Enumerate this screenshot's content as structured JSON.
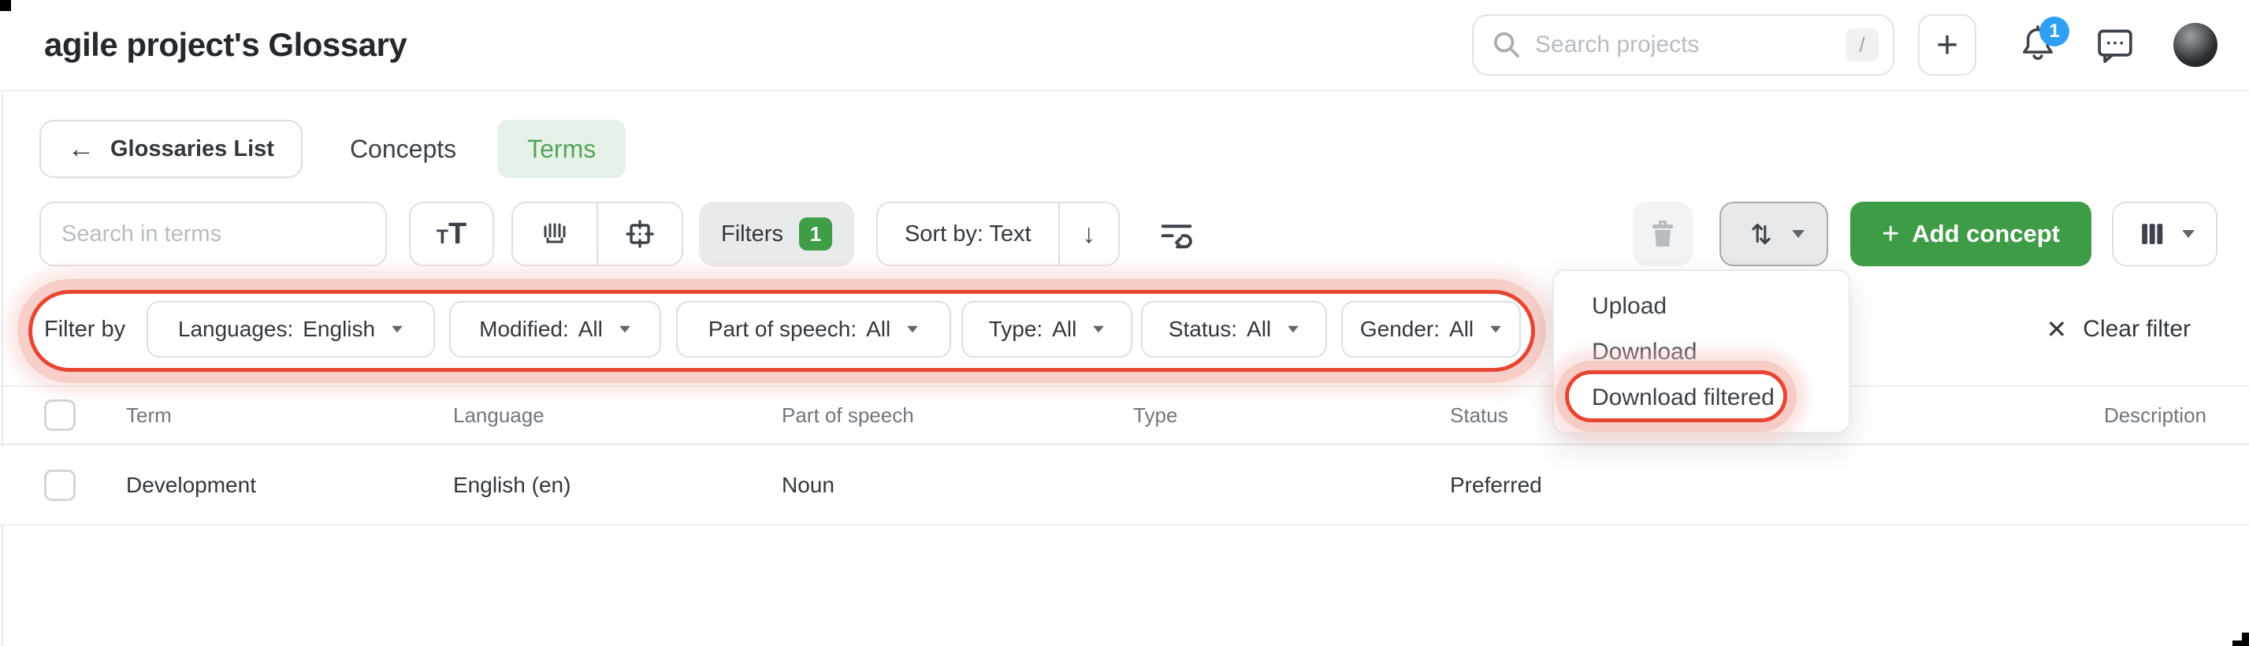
{
  "header": {
    "title": "agile project's Glossary",
    "search_placeholder": "Search projects",
    "search_shortcut": "/",
    "notification_count": "1"
  },
  "nav": {
    "back_label": "Glossaries List",
    "tabs": [
      {
        "label": "Concepts",
        "active": false
      },
      {
        "label": "Terms",
        "active": true
      }
    ]
  },
  "toolbar": {
    "search_placeholder": "Search in terms",
    "filters_label": "Filters",
    "filters_count": "1",
    "sort_label": "Sort by: Text",
    "add_concept_label": "Add concept"
  },
  "icons": {
    "plus": "+",
    "back_arrow": "←",
    "sort_arrow": "↓",
    "clear_x": "✕"
  },
  "filter_bar": {
    "label": "Filter by",
    "pills": [
      {
        "name": "Languages:",
        "value": "English"
      },
      {
        "name": "Modified:",
        "value": "All"
      },
      {
        "name": "Part of speech:",
        "value": "All"
      },
      {
        "name": "Type:",
        "value": "All"
      },
      {
        "name": "Status:",
        "value": "All"
      },
      {
        "name": "Gender:",
        "value": "All"
      }
    ],
    "clear_label": "Clear filter"
  },
  "dropdown_menu": {
    "items": [
      "Upload",
      "Download",
      "Download filtered"
    ],
    "highlighted_item": "Download filtered"
  },
  "table": {
    "columns": [
      "Term",
      "Language",
      "Part of speech",
      "Type",
      "Status",
      "Description"
    ],
    "rows": [
      {
        "term": "Development",
        "language": "English (en)",
        "part_of_speech": "Noun",
        "type": "",
        "status": "Preferred",
        "description": ""
      }
    ]
  },
  "colors": {
    "accent_green": "#3e9c46",
    "badge_green": "#3f9e46",
    "terms_tab_bg": "#e6f2e7",
    "terms_tab_text": "#55a35c",
    "notification_blue": "#2f9ff4",
    "annotation_red": "#e74631"
  }
}
